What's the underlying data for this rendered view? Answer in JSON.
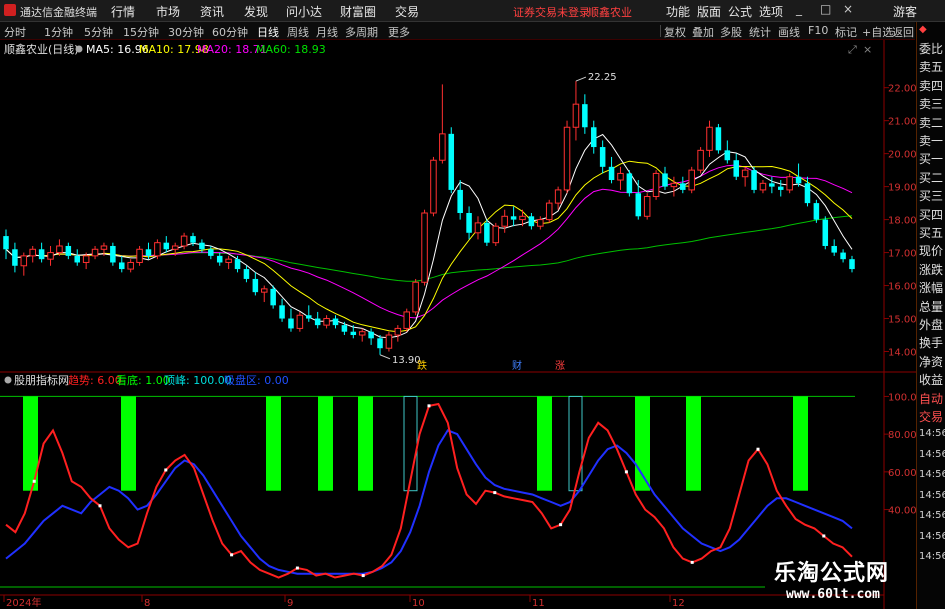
{
  "menubar": {
    "app_name": "通达信金融终端",
    "menu": [
      "行情",
      "市场",
      "资讯",
      "发现",
      "问小达",
      "财富圈",
      "交易"
    ],
    "warning": "证券交易未登录",
    "stock_name": "顺鑫农业",
    "right_menu": [
      "功能",
      "版面",
      "公式",
      "选项"
    ],
    "window_buttons": [
      "_",
      "□",
      "×"
    ],
    "user_label": "游客"
  },
  "period_bar": {
    "tabs": [
      "分时",
      "1分钟",
      "5分钟",
      "15分钟",
      "30分钟",
      "60分钟",
      "日线",
      "周线",
      "月线",
      "多周期",
      "更多"
    ],
    "active": "日线",
    "tools": [
      "复权",
      "叠加",
      "多股",
      "统计",
      "画线",
      "F10",
      "标记",
      "+自选",
      "返回"
    ]
  },
  "side_panel": {
    "items": [
      "委比",
      "卖五",
      "卖四",
      "卖三",
      "卖二",
      "卖一",
      "买一",
      "买二",
      "买三",
      "买四",
      "买五",
      "现价",
      "涨跌",
      "涨幅",
      "总量",
      "外盘",
      "换手",
      "净资",
      "收益",
      "自动",
      "交易"
    ],
    "times": [
      "14:56",
      "14:56",
      "14:56",
      "14:56",
      "14:56",
      "14:56",
      "14:56"
    ]
  },
  "price_header": {
    "title": "顺鑫农业(日线)",
    "ma5": "MA5: 16.96",
    "ma10": "MA10: 17.98",
    "ma20": "MA20: 18.71",
    "ma60": "MA60: 18.93"
  },
  "indicator_header": {
    "title": "股朋指标网",
    "trend": "趋势: 6.00",
    "bottom": "看底: 1.00",
    "top": "顶峰: 100.00",
    "extra": "吸盘区: 0.00"
  },
  "chart_data": {
    "type": "candlestick",
    "price_axis": {
      "ticks": [
        22.0,
        21.0,
        20.0,
        19.0,
        18.0,
        17.0,
        16.0,
        15.0,
        14.0
      ],
      "range": [
        13.5,
        22.9
      ]
    },
    "indicator_axis": {
      "ticks": [
        100.0,
        80.0,
        60.0,
        40.0
      ],
      "range": [
        0,
        105
      ]
    },
    "x_labels": [
      "2024年",
      "8",
      "9",
      "10",
      "11",
      "12"
    ],
    "annotations": {
      "high": "22.25",
      "low": "13.90"
    },
    "event_markers": [
      "跌",
      "财",
      "涨"
    ],
    "colors": {
      "up": "#ff3030",
      "down": "#00ffff",
      "ma5": "#ffffff",
      "ma10": "#ffff00",
      "ma20": "#ff00ff",
      "ma60": "#00c000",
      "trend": "#ff2020",
      "signal": "#2030ff",
      "bar": "#00ff00"
    },
    "candles": [
      [
        17.5,
        17.7,
        16.8,
        17.1
      ],
      [
        17.1,
        17.3,
        16.4,
        16.6
      ],
      [
        16.6,
        17.0,
        16.3,
        16.9
      ],
      [
        16.9,
        17.2,
        16.7,
        17.1
      ],
      [
        17.1,
        17.3,
        16.7,
        16.8
      ],
      [
        16.8,
        17.2,
        16.6,
        17.0
      ],
      [
        17.0,
        17.4,
        16.9,
        17.2
      ],
      [
        17.2,
        17.3,
        16.8,
        16.9
      ],
      [
        16.9,
        17.1,
        16.6,
        16.7
      ],
      [
        16.7,
        17.0,
        16.5,
        16.9
      ],
      [
        16.9,
        17.2,
        16.8,
        17.1
      ],
      [
        17.1,
        17.3,
        16.9,
        17.2
      ],
      [
        17.2,
        17.3,
        16.6,
        16.7
      ],
      [
        16.7,
        16.9,
        16.4,
        16.5
      ],
      [
        16.5,
        16.8,
        16.4,
        16.7
      ],
      [
        16.7,
        17.2,
        16.6,
        17.1
      ],
      [
        17.1,
        17.3,
        16.8,
        16.9
      ],
      [
        16.9,
        17.4,
        16.8,
        17.3
      ],
      [
        17.3,
        17.5,
        17.0,
        17.1
      ],
      [
        17.1,
        17.3,
        16.9,
        17.2
      ],
      [
        17.2,
        17.6,
        17.1,
        17.5
      ],
      [
        17.5,
        17.6,
        17.2,
        17.3
      ],
      [
        17.3,
        17.4,
        17.0,
        17.1
      ],
      [
        17.1,
        17.2,
        16.8,
        16.9
      ],
      [
        16.9,
        17.0,
        16.6,
        16.7
      ],
      [
        16.7,
        16.9,
        16.5,
        16.8
      ],
      [
        16.8,
        16.9,
        16.4,
        16.5
      ],
      [
        16.5,
        16.6,
        16.1,
        16.2
      ],
      [
        16.2,
        16.4,
        15.7,
        15.8
      ],
      [
        15.8,
        16.0,
        15.5,
        15.9
      ],
      [
        15.9,
        16.0,
        15.3,
        15.4
      ],
      [
        15.4,
        15.6,
        14.9,
        15.0
      ],
      [
        15.0,
        15.3,
        14.6,
        14.7
      ],
      [
        14.7,
        15.2,
        14.6,
        15.1
      ],
      [
        15.1,
        15.4,
        14.9,
        15.0
      ],
      [
        15.0,
        15.2,
        14.7,
        14.8
      ],
      [
        14.8,
        15.1,
        14.7,
        15.0
      ],
      [
        15.0,
        15.1,
        14.7,
        14.8
      ],
      [
        14.8,
        14.9,
        14.5,
        14.6
      ],
      [
        14.6,
        14.8,
        14.4,
        14.5
      ],
      [
        14.5,
        14.7,
        14.3,
        14.6
      ],
      [
        14.6,
        14.7,
        14.2,
        14.4
      ],
      [
        14.4,
        14.5,
        13.9,
        14.1
      ],
      [
        14.1,
        14.6,
        14.0,
        14.5
      ],
      [
        14.5,
        14.8,
        14.3,
        14.7
      ],
      [
        14.7,
        15.3,
        14.6,
        15.2
      ],
      [
        15.2,
        16.2,
        15.1,
        16.1
      ],
      [
        16.1,
        18.3,
        16.0,
        18.2
      ],
      [
        18.2,
        19.9,
        18.1,
        19.8
      ],
      [
        19.8,
        22.1,
        19.7,
        20.6
      ],
      [
        20.6,
        20.8,
        18.8,
        18.9
      ],
      [
        18.9,
        19.2,
        18.0,
        18.2
      ],
      [
        18.2,
        18.4,
        17.4,
        17.6
      ],
      [
        17.6,
        18.1,
        17.4,
        17.9
      ],
      [
        17.9,
        18.0,
        17.2,
        17.3
      ],
      [
        17.3,
        17.9,
        17.2,
        17.8
      ],
      [
        17.8,
        18.3,
        17.6,
        18.1
      ],
      [
        18.1,
        18.4,
        17.8,
        18.0
      ],
      [
        18.0,
        18.3,
        17.8,
        18.1
      ],
      [
        18.1,
        18.2,
        17.7,
        17.8
      ],
      [
        17.8,
        18.1,
        17.7,
        18.0
      ],
      [
        18.0,
        18.6,
        17.9,
        18.5
      ],
      [
        18.5,
        19.0,
        18.3,
        18.9
      ],
      [
        18.9,
        21.0,
        18.8,
        20.8
      ],
      [
        20.8,
        22.2,
        20.4,
        21.5
      ],
      [
        21.5,
        21.8,
        20.6,
        20.8
      ],
      [
        20.8,
        21.0,
        20.0,
        20.2
      ],
      [
        20.2,
        20.4,
        19.4,
        19.6
      ],
      [
        19.6,
        19.9,
        19.1,
        19.2
      ],
      [
        19.2,
        19.6,
        18.9,
        19.4
      ],
      [
        19.4,
        19.5,
        18.7,
        18.8
      ],
      [
        18.8,
        19.2,
        18.0,
        18.1
      ],
      [
        18.1,
        18.8,
        18.0,
        18.7
      ],
      [
        18.7,
        19.5,
        18.6,
        19.4
      ],
      [
        19.4,
        19.6,
        18.9,
        19.0
      ],
      [
        19.0,
        19.3,
        18.7,
        19.1
      ],
      [
        19.1,
        19.3,
        18.8,
        18.9
      ],
      [
        18.9,
        19.6,
        18.8,
        19.5
      ],
      [
        19.5,
        20.2,
        19.4,
        20.1
      ],
      [
        20.1,
        21.0,
        19.9,
        20.8
      ],
      [
        20.8,
        20.9,
        20.0,
        20.1
      ],
      [
        20.1,
        20.4,
        19.7,
        19.8
      ],
      [
        19.8,
        20.0,
        19.2,
        19.3
      ],
      [
        19.3,
        19.6,
        19.0,
        19.5
      ],
      [
        19.5,
        19.6,
        18.8,
        18.9
      ],
      [
        18.9,
        19.2,
        18.8,
        19.1
      ],
      [
        19.1,
        19.3,
        18.8,
        19.0
      ],
      [
        19.0,
        19.2,
        18.7,
        18.9
      ],
      [
        18.9,
        19.4,
        18.8,
        19.3
      ],
      [
        19.3,
        19.7,
        19.0,
        19.1
      ],
      [
        19.1,
        19.3,
        18.4,
        18.5
      ],
      [
        18.5,
        18.6,
        17.9,
        18.0
      ],
      [
        18.0,
        18.1,
        17.1,
        17.2
      ],
      [
        17.2,
        17.4,
        16.9,
        17.0
      ],
      [
        17.0,
        17.1,
        16.7,
        16.8
      ],
      [
        16.8,
        16.9,
        16.4,
        16.5
      ]
    ],
    "trend": [
      32,
      28,
      38,
      55,
      75,
      82,
      70,
      55,
      52,
      46,
      42,
      30,
      24,
      20,
      22,
      38,
      52,
      61,
      66,
      69,
      62,
      48,
      34,
      22,
      16,
      18,
      12,
      8,
      6,
      4,
      6,
      9,
      8,
      5,
      6,
      4,
      5,
      6,
      5,
      7,
      10,
      16,
      30,
      55,
      80,
      95,
      96,
      86,
      62,
      48,
      43,
      50,
      49,
      47,
      46,
      45,
      44,
      38,
      30,
      32,
      40,
      60,
      78,
      86,
      82,
      72,
      60,
      48,
      40,
      36,
      30,
      20,
      14,
      12,
      14,
      18,
      20,
      30,
      48,
      66,
      72,
      64,
      50,
      42,
      35,
      32,
      30,
      26,
      22,
      20,
      15
    ],
    "signal": [
      14,
      18,
      22,
      28,
      34,
      38,
      42,
      40,
      38,
      44,
      48,
      52,
      50,
      46,
      40,
      42,
      48,
      55,
      62,
      66,
      64,
      58,
      50,
      42,
      34,
      26,
      20,
      14,
      10,
      8,
      7,
      6,
      6,
      6,
      6,
      6,
      6,
      6,
      6,
      7,
      9,
      12,
      18,
      28,
      42,
      60,
      74,
      82,
      80,
      72,
      64,
      57,
      53,
      51,
      50,
      49,
      48,
      46,
      44,
      42,
      44,
      50,
      58,
      66,
      72,
      74,
      70,
      64,
      56,
      48,
      42,
      36,
      30,
      26,
      22,
      20,
      18,
      20,
      24,
      30,
      36,
      42,
      46,
      46,
      44,
      42,
      40,
      38,
      36,
      34,
      30
    ],
    "green_bars": [
      18,
      25,
      64,
      77,
      89,
      134,
      155,
      172,
      196
    ],
    "outline_bars": [
      102,
      143
    ]
  },
  "watermark": {
    "name": "乐淘公式网",
    "url": "www.60lt.com"
  }
}
